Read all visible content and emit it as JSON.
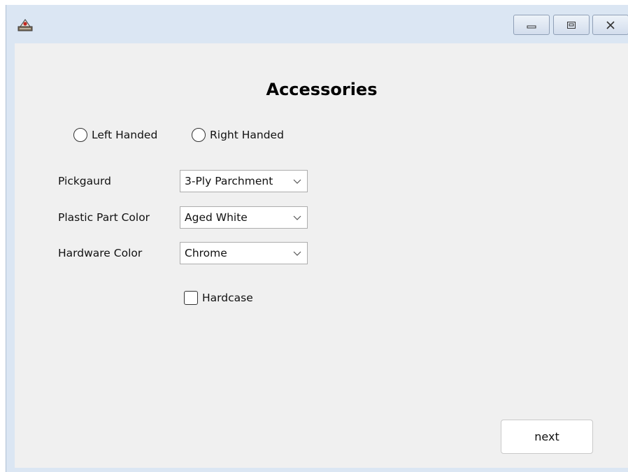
{
  "window": {
    "app_icon": "java-duke-icon",
    "controls": {
      "minimize": "minimize-icon",
      "maximize": "maximize-icon",
      "close": "close-icon"
    }
  },
  "form": {
    "title": "Accessories",
    "handedness": [
      {
        "label": "Left Handed",
        "selected": false
      },
      {
        "label": "Right Handed",
        "selected": false
      }
    ],
    "fields": [
      {
        "label": "Pickgaurd",
        "value": "3-Ply Parchment"
      },
      {
        "label": "Plastic Part Color",
        "value": "Aged White"
      },
      {
        "label": "Hardware Color",
        "value": "Chrome"
      }
    ],
    "hardcase": {
      "label": "Hardcase",
      "checked": false
    },
    "next_label": "next"
  }
}
